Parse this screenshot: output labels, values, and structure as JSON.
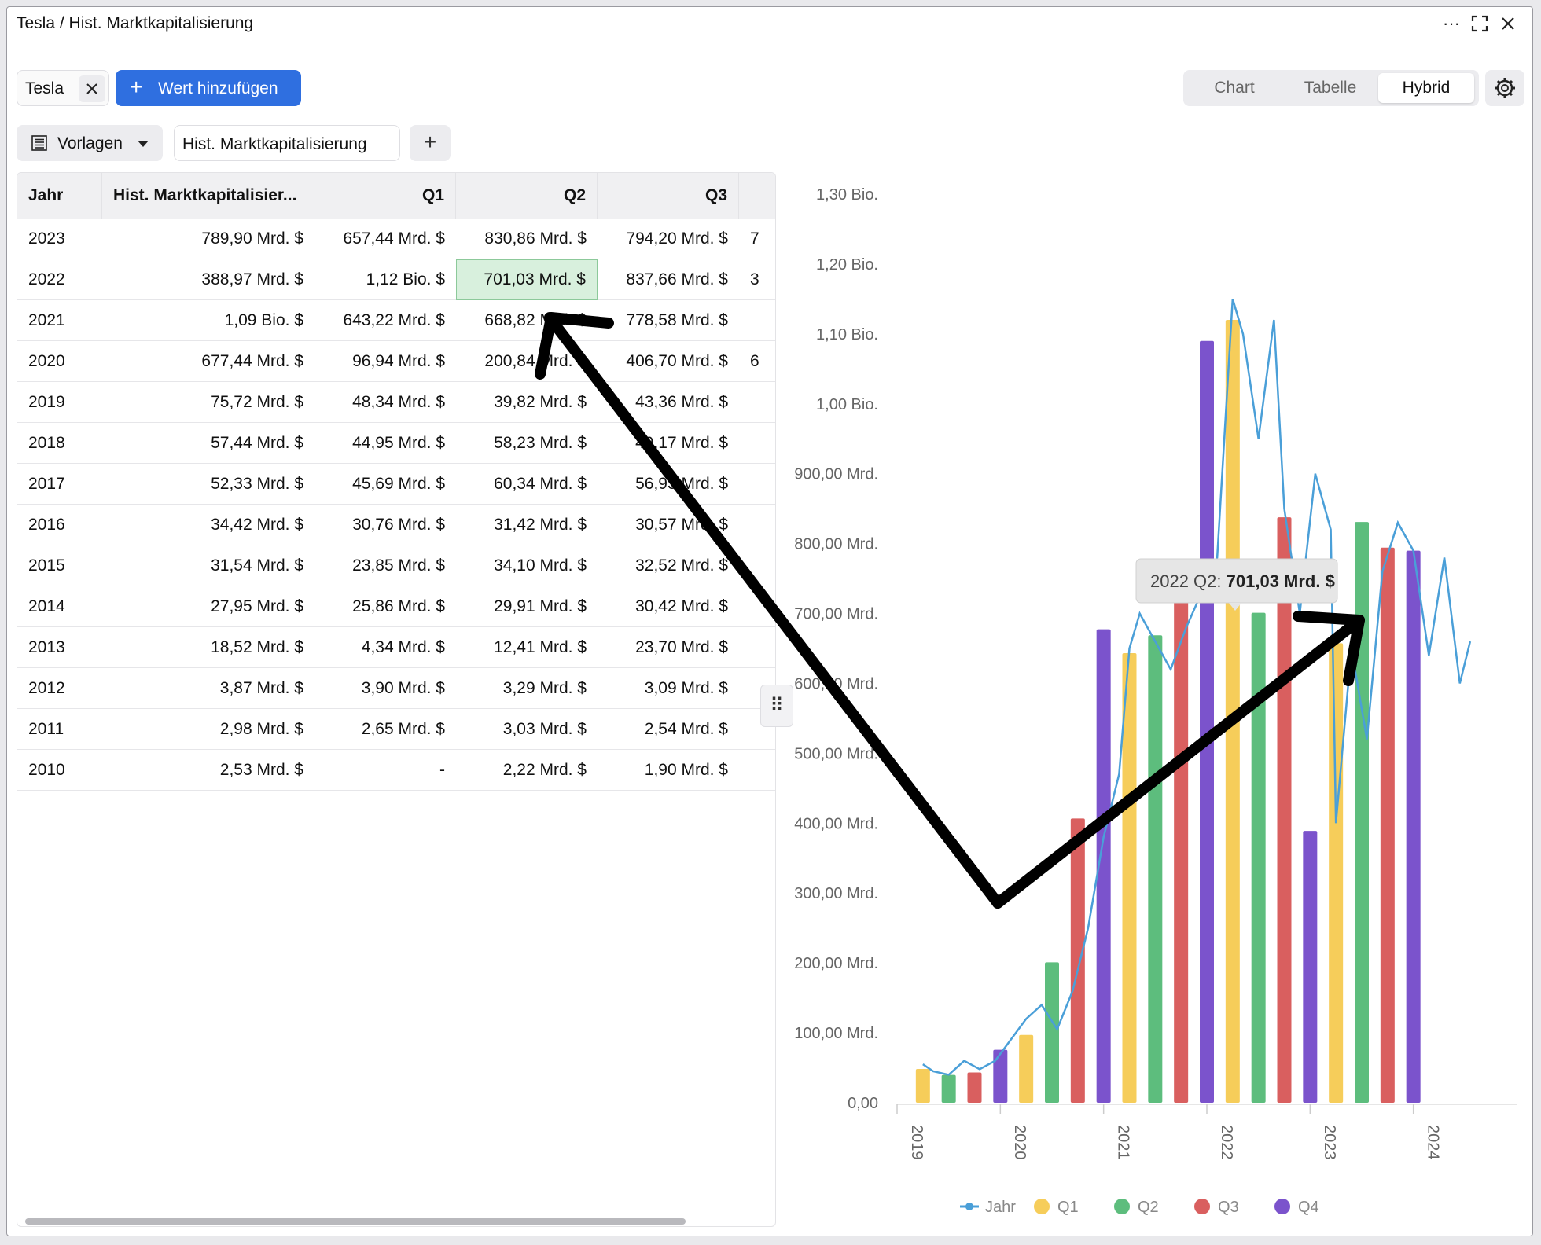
{
  "window": {
    "title": "Tesla / Hist. Marktkapitalisierung"
  },
  "toolbar": {
    "chip_label": "Tesla",
    "add_label": "Wert hinzufügen",
    "views": [
      "Chart",
      "Tabelle",
      "Hybrid"
    ],
    "active_view": "Hybrid",
    "templates_label": "Vorlagen",
    "metric_label": "Hist. Marktkapitalisierung",
    "add_column": "+"
  },
  "table": {
    "columns": [
      "Jahr",
      "Hist. Marktkapitalisier...",
      "Q1",
      "Q2",
      "Q3"
    ],
    "rows": [
      [
        "2023",
        "789,90 Mrd. $",
        "657,44 Mrd. $",
        "830,86 Mrd. $",
        "794,20 Mrd. $",
        "7"
      ],
      [
        "2022",
        "388,97 Mrd. $",
        "1,12 Bio. $",
        "701,03 Mrd. $",
        "837,66 Mrd. $",
        "3"
      ],
      [
        "2021",
        "1,09 Bio. $",
        "643,22 Mrd. $",
        "668,82 Mrd. $",
        "778,58 Mrd. $",
        ""
      ],
      [
        "2020",
        "677,44 Mrd. $",
        "96,94 Mrd. $",
        "200,84 Mrd. $",
        "406,70 Mrd. $",
        "6"
      ],
      [
        "2019",
        "75,72 Mrd. $",
        "48,34 Mrd. $",
        "39,82 Mrd. $",
        "43,36 Mrd. $",
        ""
      ],
      [
        "2018",
        "57,44 Mrd. $",
        "44,95 Mrd. $",
        "58,23 Mrd. $",
        "49,17 Mrd. $",
        ""
      ],
      [
        "2017",
        "52,33 Mrd. $",
        "45,69 Mrd. $",
        "60,34 Mrd. $",
        "56,93 Mrd. $",
        ""
      ],
      [
        "2016",
        "34,42 Mrd. $",
        "30,76 Mrd. $",
        "31,42 Mrd. $",
        "30,57 Mrd. $",
        ""
      ],
      [
        "2015",
        "31,54 Mrd. $",
        "23,85 Mrd. $",
        "34,10 Mrd. $",
        "32,52 Mrd. $",
        ""
      ],
      [
        "2014",
        "27,95 Mrd. $",
        "25,86 Mrd. $",
        "29,91 Mrd. $",
        "30,42 Mrd. $",
        ""
      ],
      [
        "2013",
        "18,52 Mrd. $",
        "4,34 Mrd. $",
        "12,41 Mrd. $",
        "23,70 Mrd. $",
        ""
      ],
      [
        "2012",
        "3,87 Mrd. $",
        "3,90 Mrd. $",
        "3,29 Mrd. $",
        "3,09 Mrd. $",
        ""
      ],
      [
        "2011",
        "2,98 Mrd. $",
        "2,65 Mrd. $",
        "3,03 Mrd. $",
        "2,54 Mrd. $",
        ""
      ],
      [
        "2010",
        "2,53 Mrd. $",
        "-",
        "2,22 Mrd. $",
        "1,90 Mrd. $",
        ""
      ]
    ],
    "highlighted": {
      "row": 1,
      "col": 3
    }
  },
  "colors": {
    "jahr": "#4a9fd8",
    "q1": "#f6cd5a",
    "q2": "#5dbd7d",
    "q3": "#d95f5f",
    "q4": "#7b53cc",
    "accent": "#2f6fe0"
  },
  "chart_data": {
    "type": "bar",
    "yticks": [
      "0,00",
      "100,00 Mrd.",
      "200,00 Mrd.",
      "300,00 Mrd.",
      "400,00 Mrd.",
      "500,00 Mrd.",
      "600,00 Mrd.",
      "700,00 Mrd.",
      "800,00 Mrd.",
      "900,00 Mrd.",
      "1,00 Bio.",
      "1,10 Bio.",
      "1,20 Bio.",
      "1,30 Bio."
    ],
    "ylim": [
      0,
      1300
    ],
    "xlim": [
      2018.75,
      2024.75
    ],
    "xticks": [
      "2019",
      "2020",
      "2021",
      "2022",
      "2023",
      "2024"
    ],
    "legend": [
      "Jahr",
      "Q1",
      "Q2",
      "Q3",
      "Q4"
    ],
    "legend_position": "bottom",
    "tooltip": {
      "prefix": "2022 Q2: ",
      "value": "701,03 Mrd. $"
    },
    "bars": [
      {
        "series": "Q1",
        "x": 2019.0,
        "value": 48.34
      },
      {
        "series": "Q2",
        "x": 2019.25,
        "value": 39.82
      },
      {
        "series": "Q3",
        "x": 2019.5,
        "value": 43.36
      },
      {
        "series": "Q4",
        "x": 2019.75,
        "value": 75.72
      },
      {
        "series": "Q1",
        "x": 2020.0,
        "value": 96.94
      },
      {
        "series": "Q2",
        "x": 2020.25,
        "value": 200.84
      },
      {
        "series": "Q3",
        "x": 2020.5,
        "value": 406.7
      },
      {
        "series": "Q4",
        "x": 2020.75,
        "value": 677.44
      },
      {
        "series": "Q1",
        "x": 2021.0,
        "value": 643.22
      },
      {
        "series": "Q2",
        "x": 2021.25,
        "value": 668.82
      },
      {
        "series": "Q3",
        "x": 2021.5,
        "value": 778.58
      },
      {
        "series": "Q4",
        "x": 2021.75,
        "value": 1090
      },
      {
        "series": "Q1",
        "x": 2022.0,
        "value": 1120
      },
      {
        "series": "Q2",
        "x": 2022.25,
        "value": 701.03
      },
      {
        "series": "Q3",
        "x": 2022.5,
        "value": 837.66
      },
      {
        "series": "Q4",
        "x": 2022.75,
        "value": 388.97
      },
      {
        "series": "Q1",
        "x": 2023.0,
        "value": 657.44
      },
      {
        "series": "Q2",
        "x": 2023.25,
        "value": 830.86
      },
      {
        "series": "Q3",
        "x": 2023.5,
        "value": 794.2
      },
      {
        "series": "Q4",
        "x": 2023.75,
        "value": 789.9
      }
    ],
    "line": {
      "name": "Jahr",
      "x": [
        2019.0,
        2019.1,
        2019.25,
        2019.4,
        2019.55,
        2019.7,
        2019.85,
        2020.0,
        2020.15,
        2020.3,
        2020.45,
        2020.6,
        2020.75,
        2020.9,
        2021.0,
        2021.1,
        2021.25,
        2021.4,
        2021.55,
        2021.7,
        2021.85,
        2022.0,
        2022.1,
        2022.25,
        2022.4,
        2022.5,
        2022.65,
        2022.8,
        2022.95,
        2023.0,
        2023.15,
        2023.3,
        2023.45,
        2023.6,
        2023.75,
        2023.9,
        2024.05,
        2024.2,
        2024.3
      ],
      "y": [
        55,
        45,
        40,
        60,
        48,
        60,
        90,
        120,
        140,
        105,
        160,
        250,
        380,
        470,
        650,
        700,
        660,
        620,
        680,
        730,
        780,
        1150,
        1100,
        950,
        1120,
        850,
        700,
        900,
        820,
        400,
        650,
        520,
        760,
        830,
        790,
        640,
        780,
        600,
        660
      ]
    }
  }
}
